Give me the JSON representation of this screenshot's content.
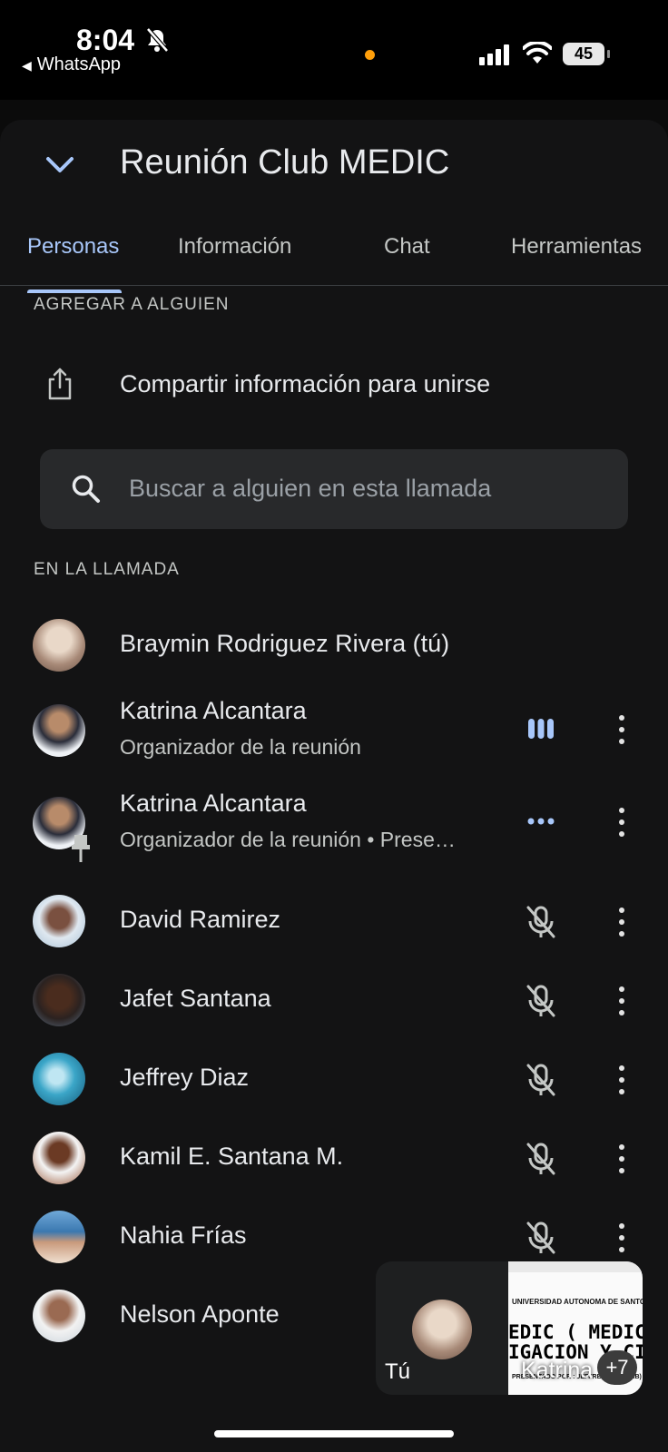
{
  "status_bar": {
    "time": "8:04",
    "back_app": "WhatsApp",
    "battery": "45"
  },
  "header": {
    "title": "Reunión Club MEDIC"
  },
  "tabs": [
    {
      "label": "Personas",
      "active": true
    },
    {
      "label": "Información",
      "active": false
    },
    {
      "label": "Chat",
      "active": false
    },
    {
      "label": "Herramientas",
      "active": false
    }
  ],
  "add_section": {
    "label": "AGREGAR A ALGUIEN",
    "share_label": "Compartir información para unirse"
  },
  "search": {
    "placeholder": "Buscar a alguien en esta llamada"
  },
  "call_section": {
    "label": "EN LA LLAMADA"
  },
  "participants": [
    {
      "name": "Braymin Rodriguez Rivera (tú)",
      "subtitle": "",
      "status": "none"
    },
    {
      "name": "Katrina Alcantara",
      "subtitle": "Organizador de la reunión",
      "status": "speaking"
    },
    {
      "name": "Katrina Alcantara",
      "subtitle": "Organizador de la reunión • Prese…",
      "status": "presenting"
    },
    {
      "name": "David Ramirez",
      "subtitle": "",
      "status": "muted"
    },
    {
      "name": "Jafet Santana",
      "subtitle": "",
      "status": "muted"
    },
    {
      "name": "Jeffrey Diaz",
      "subtitle": "",
      "status": "muted"
    },
    {
      "name": "Kamil E. Santana M.",
      "subtitle": "",
      "status": "muted"
    },
    {
      "name": "Nahia Frías",
      "subtitle": "",
      "status": "muted"
    },
    {
      "name": "Nelson Aponte",
      "subtitle": "",
      "status": "hidden"
    }
  ],
  "pip": {
    "you_label": "Tú",
    "presenter_name": "Katrina",
    "more_count": "+7",
    "slide": {
      "line1": "UNIVERSIDAD AUTONOMA DE SANTO DOMINGO",
      "line2": "EDIC ( MEDICINA",
      "line3": "IGACION Y CIENC",
      "line4": "PRESENTADO POR : JEFFREY DIAZ (CAB)"
    }
  },
  "colors": {
    "accent": "#a8c7fa",
    "sheet_bg": "#131314",
    "search_bg": "#28292b"
  }
}
